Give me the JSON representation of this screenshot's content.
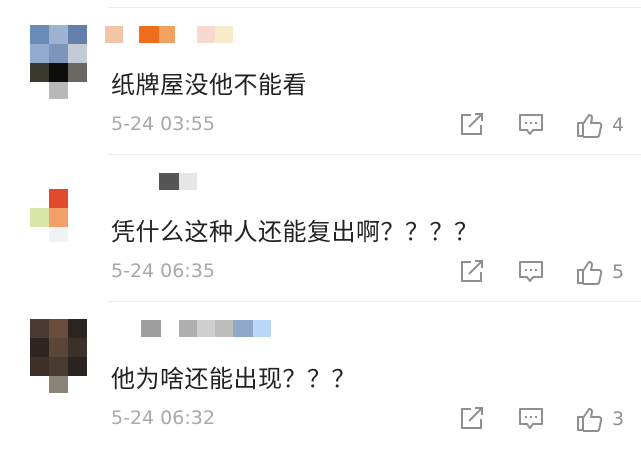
{
  "comments": [
    {
      "text": "纸牌屋没他不能看",
      "time": "5-24 03:55",
      "likes": "4",
      "avatar_colors": [
        "#6a8cb8",
        "#9fb2cf",
        "#6380ab",
        "#94abd0",
        "#7d95bb",
        "#c2cbd6",
        "#3b3a2e",
        "#0d0d0d",
        "#6a6760",
        "",
        "#b8b8b8",
        ""
      ],
      "username_colors": [
        "#f2c4a8",
        "#f06d1b",
        "#f0a060",
        "#f7d9cf",
        "#f7ecc9"
      ]
    },
    {
      "text": "凭什么这种人还能复出啊？？？？",
      "time": "5-24 06:35",
      "likes": "5",
      "avatar_colors": [
        "",
        "#e14a2a",
        "",
        "#d9e6a7",
        "#f2a068",
        "",
        "",
        "#f2f2f2",
        ""
      ],
      "username_colors": [
        "#555555",
        "#e6e6e6"
      ]
    },
    {
      "text": "他为啥还能出现？？？",
      "time": "5-24 06:32",
      "likes": "3",
      "avatar_colors": [
        "#4a3a33",
        "#6a4d3d",
        "#2b2420",
        "#2e2520",
        "#5a4536",
        "#3b302a",
        "#3d3028",
        "#473a30",
        "#2a2420",
        "",
        "#8a8478",
        ""
      ],
      "username_colors": [
        "#9e9e9e",
        "#b0b0b0",
        "#cfcfcf",
        "#bdbdbd",
        "#8fa9c9",
        "#b9d9f7"
      ]
    }
  ]
}
